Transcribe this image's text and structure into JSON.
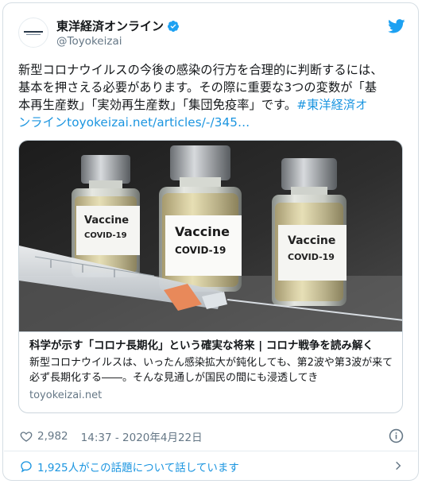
{
  "author": {
    "display_name": "東洋経済オンライン",
    "handle": "@Toyokeizai"
  },
  "tweet": {
    "text_line1": "新型コロナウイルスの今後の感染の行方を合理的に判断するには、",
    "text_line2": "基本を押さえる必要があります。その際に重要な3つの変数が「基",
    "text_line3a": "本再生産数」「実効再生産数」「集団免疫率」です。",
    "hashtag_part1": "#東洋経済オ",
    "hashtag_part2": "ンライン",
    "link": "toyokeizai.net/articles/-/345…"
  },
  "link_card": {
    "title": "科学が示す「コロナ長期化」という確実な将来 | コロナ戦争を読み解く",
    "description": "新型コロナウイルスは、いったん感染拡大が鈍化しても、第2波や第3波が来て必ず長期化する――。そんな見通しが国民の間にも浸透してき",
    "domain": "toyokeizai.net",
    "image": {
      "vial_label_line1": "Vaccine",
      "vial_label_line2": "COVID-19"
    }
  },
  "meta": {
    "likes": "2,982",
    "timestamp": "14:37 - 2020年4月22日"
  },
  "discussion": {
    "label": "1,925人がこの話題について話しています"
  },
  "colors": {
    "link_blue": "#1b95e0",
    "muted_gray": "#657786",
    "border": "#ccd6dd"
  },
  "icons": {
    "verified": "verified-badge-icon",
    "bird": "twitter-bird-icon",
    "heart": "heart-icon",
    "info": "info-icon",
    "bubble": "speech-bubble-icon",
    "chevron": "chevron-right-icon"
  }
}
